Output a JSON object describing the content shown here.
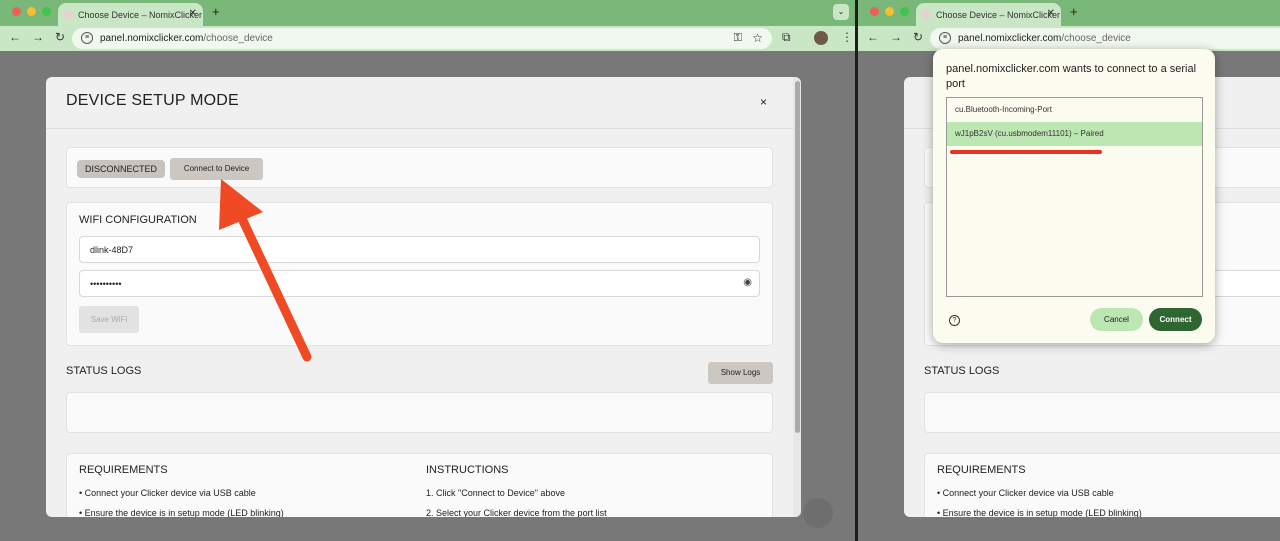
{
  "browser": {
    "tab_title": "Choose Device – NomixClicker",
    "tab_close": "✕",
    "new_tab": "+",
    "tab_menu": "⌄",
    "url_host": "panel.nomixclicker.com",
    "url_path": "/choose_device"
  },
  "modal": {
    "title": "DEVICE SETUP MODE",
    "close": "×",
    "status_badge": "DISCONNECTED",
    "connect_button": "Connect to Device",
    "wifi": {
      "title": "WIFI CONFIGURATION",
      "ssid": "dlink-48D7",
      "password": "••••••••••",
      "save_button": "Save WiFi"
    },
    "logs": {
      "title": "STATUS LOGS",
      "show_button": "Show Logs"
    },
    "requirements": {
      "title": "REQUIREMENTS",
      "items": [
        "Connect your Clicker device via USB cable",
        "Ensure the device is in setup mode (LED blinking)"
      ]
    },
    "instructions": {
      "title": "INSTRUCTIONS",
      "items": [
        "1. Click \"Connect to Device\" above",
        "2. Select your Clicker device from the port list"
      ]
    }
  },
  "serial_dialog": {
    "title": "panel.nomixclicker.com wants to connect to a serial port",
    "ports": [
      {
        "label": "cu.Bluetooth-Incoming-Port",
        "selected": false
      },
      {
        "label": "wJ1pB2sV (cu.usbmodem11101) – Paired",
        "selected": true
      }
    ],
    "help": "?",
    "cancel_button": "Cancel",
    "connect_button": "Connect"
  },
  "colors": {
    "chrome_green": "#7ab87a",
    "toolbar_green": "#c9e6c5",
    "annotation_red": "#f04a24",
    "connect_dark": "#2f6530"
  },
  "icons": [
    "back-icon",
    "forward-icon",
    "reload-icon",
    "site-settings-icon",
    "key-icon",
    "star-icon",
    "extensions-icon",
    "avatar",
    "kebab-menu-icon",
    "eye-icon",
    "help-icon"
  ]
}
